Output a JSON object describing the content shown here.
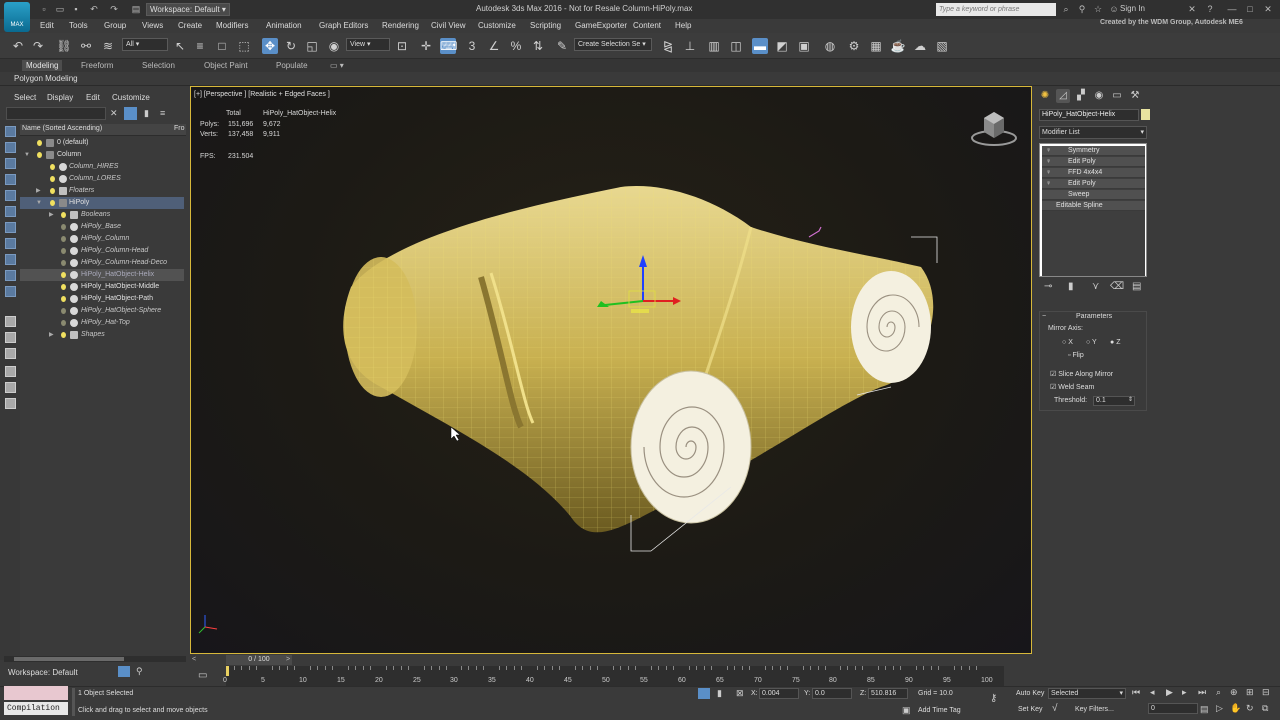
{
  "titlebar": {
    "workspace": "Workspace: Default",
    "title": "Autodesk 3ds Max 2016 - Not for Resale   Column-HiPoly.max",
    "search_placeholder": "Type a keyword or phrase",
    "sign_in": "Sign In",
    "credit": "Created by the WDM Group, Autodesk ME6",
    "app_icon_label": "MAX"
  },
  "menu": [
    "Edit",
    "Tools",
    "Group",
    "Views",
    "Create",
    "Modifiers",
    "Animation",
    "Graph Editors",
    "Rendering",
    "Civil View",
    "Customize",
    "Scripting",
    "GameExporter",
    "Content",
    "Help"
  ],
  "toolbar": {
    "selection_filter": "All",
    "ref_coord": "View",
    "named_selection": "Create Selection Se"
  },
  "ribbon": {
    "tabs": [
      "Modeling",
      "Freeform",
      "Selection",
      "Object Paint",
      "Populate"
    ],
    "active_tab": "Modeling",
    "sub": "Polygon Modeling"
  },
  "explorer": {
    "menu": [
      "Select",
      "Display",
      "Edit",
      "Customize"
    ],
    "header": "Name (Sorted Ascending)",
    "header2": "Fro",
    "rows": [
      {
        "label": "0 (default)"
      },
      {
        "label": "Column"
      },
      {
        "label": "Column_HIRES"
      },
      {
        "label": "Column_LORES"
      },
      {
        "label": "Floaters"
      },
      {
        "label": "HiPoly"
      },
      {
        "label": "Booleans"
      },
      {
        "label": "HiPoly_Base"
      },
      {
        "label": "HiPoly_Column"
      },
      {
        "label": "HiPoly_Column-Head"
      },
      {
        "label": "HiPoly_Column-Head-Deco"
      },
      {
        "label": "HiPoly_HatObject-Helix"
      },
      {
        "label": "HiPoly_HatObject-Middle"
      },
      {
        "label": "HiPoly_HatObject-Path"
      },
      {
        "label": "HiPoly_HatObject-Sphere"
      },
      {
        "label": "HiPoly_Hat-Top"
      },
      {
        "label": "Shapes"
      }
    ],
    "workspace": "Workspace: Default"
  },
  "viewport": {
    "label": "[+] [Perspective ] [Realistic + Edged Faces ]",
    "stats": {
      "total_label": "Total",
      "object_label": "HiPoly_HatObject-Helix",
      "polys_label": "Polys:",
      "polys_total": "151,696",
      "polys_obj": "9,672",
      "verts_label": "Verts:",
      "verts_total": "137,458",
      "verts_obj": "9,911",
      "fps_label": "FPS:",
      "fps": "231.504"
    }
  },
  "command_panel": {
    "object_name": "HiPoly_HatObject-Helix",
    "modifier_list": "Modifier List",
    "stack": [
      "Symmetry",
      "Edit Poly",
      "FFD 4x4x4",
      "Edit Poly",
      "Sweep",
      "Editable Spline"
    ],
    "params_title": "Parameters",
    "mirror_axis": "Mirror Axis:",
    "axes": [
      "X",
      "Y",
      "Z"
    ],
    "flip": "Flip",
    "slice": "Slice Along Mirror",
    "weld": "Weld Seam",
    "threshold_label": "Threshold:",
    "threshold": "0.1"
  },
  "timeline": {
    "frame": "0 / 100",
    "ticks": [
      "0",
      "5",
      "10",
      "15",
      "20",
      "25",
      "30",
      "35",
      "40",
      "45",
      "50",
      "55",
      "60",
      "65",
      "70",
      "75",
      "80",
      "85",
      "90",
      "95",
      "100"
    ]
  },
  "status": {
    "compilation": "Compilation",
    "selected": "1 Object Selected",
    "prompt": "Click and drag to select and move objects",
    "x_label": "X:",
    "x": "0.004",
    "y_label": "Y:",
    "y": "0.0",
    "z_label": "Z:",
    "z": "510.816",
    "grid": "Grid = 10.0",
    "auto_key": "Auto Key",
    "set_key": "Set Key",
    "selected_dd": "Selected",
    "key_filters": "Key Filters...",
    "add_time_tag": "Add Time Tag",
    "frame_field": "0"
  }
}
